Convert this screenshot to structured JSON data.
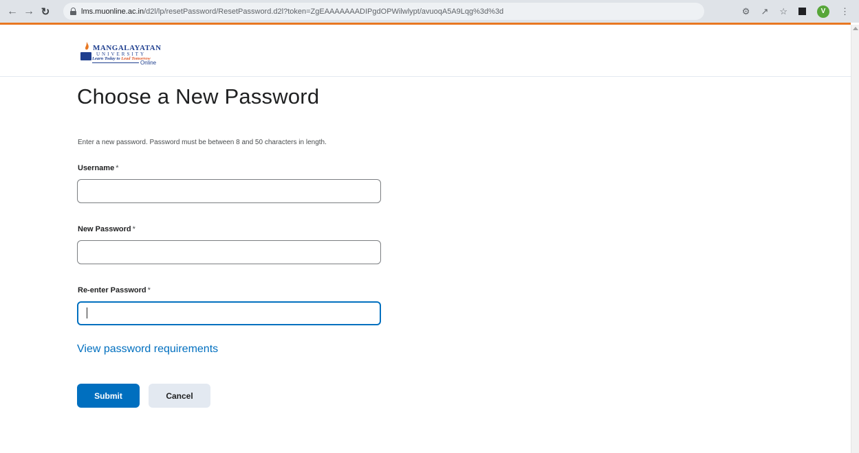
{
  "browser": {
    "url_host": "lms.muonline.ac.in",
    "url_path": "/d2l/lp/resetPassword/ResetPassword.d2l?token=ZgEAAAAAAADIPgdOPWilwlypt/avuoqA5A9Lqg%3d%3d",
    "profile_initial": "V",
    "accent_color": "#e87722"
  },
  "logo": {
    "name": "MANGALAYATAN",
    "sub": "UNIVERSITY",
    "tagline_prefix": "Learn Today to ",
    "tagline_highlight": "Lead Tomorrow",
    "online": "Online"
  },
  "page": {
    "title": "Choose a New Password",
    "intro": "Enter a new password.  Password must be between 8 and 50 characters in length."
  },
  "form": {
    "username_label": "Username",
    "new_password_label": "New Password",
    "reenter_password_label": "Re-enter Password",
    "required_marker": "*",
    "username_value": "",
    "new_password_value": "",
    "reenter_password_value": "",
    "requirements_link": "View password requirements",
    "submit_label": "Submit",
    "cancel_label": "Cancel"
  },
  "colors": {
    "primary": "#006fbf",
    "secondary_button": "#e3e9f1"
  }
}
